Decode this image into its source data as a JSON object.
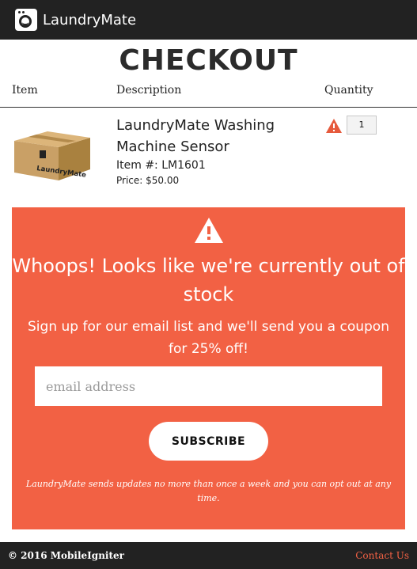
{
  "header": {
    "brand": "LaundryMate",
    "logo_icon": "washing-machine-icon",
    "bg_color": "#222222"
  },
  "page": {
    "title": "CHECKOUT"
  },
  "table": {
    "columns": [
      "Item",
      "Description",
      "Quantity"
    ]
  },
  "product": {
    "name": "LaundryMate Washing Machine Sensor",
    "item_number": "Item #: LM1601",
    "price": "Price: $50.00",
    "image_label": "LaundryMate",
    "quantity": "1",
    "warning_icon": "warning-triangle-icon"
  },
  "out_of_stock": {
    "accent_color": "#f26144",
    "heading": "Whoops! Looks like we're currently out of stock",
    "message": "Sign up for our email list and we'll send you a coupon for 25% off!",
    "email_placeholder": "email address",
    "subscribe_label": "SUBSCRIBE",
    "note": "LaundryMate sends updates no more than once a week and you can opt out at any time."
  },
  "footer": {
    "copyright": "© 2016 MobileIgniter",
    "contact": "Contact Us"
  }
}
